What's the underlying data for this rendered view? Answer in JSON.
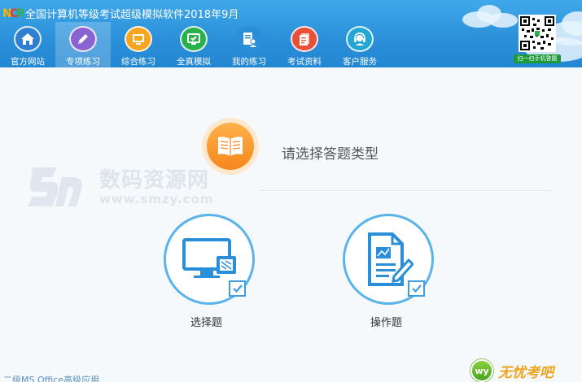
{
  "app": {
    "logo_text": "NCRE",
    "title": "全国计算机等级考试超级模拟软件2018年9月"
  },
  "nav": {
    "items": [
      {
        "label": "官方网站",
        "icon": "home-icon",
        "active": false
      },
      {
        "label": "专项练习",
        "icon": "pencil-icon",
        "active": true
      },
      {
        "label": "综合练习",
        "icon": "monitor-icon",
        "active": false
      },
      {
        "label": "全真模拟",
        "icon": "screen-check-icon",
        "active": false
      },
      {
        "label": "我的练习",
        "icon": "user-list-icon",
        "active": false
      },
      {
        "label": "考试资料",
        "icon": "documents-icon",
        "active": false
      },
      {
        "label": "客户服务",
        "icon": "headset-icon",
        "active": false
      }
    ]
  },
  "qr": {
    "caption": "扫一扫手机答题"
  },
  "main": {
    "prompt": "请选择答题类型",
    "choices": [
      {
        "label": "选择题",
        "icon": "monitor-choice-icon"
      },
      {
        "label": "操作题",
        "icon": "document-edit-icon"
      }
    ]
  },
  "watermark": {
    "big": "数码资源网",
    "url": "www.smzy.com"
  },
  "footer": {
    "subject": "二级MS Office高级应用",
    "brand_badge": "wy",
    "brand_name": "无忧考吧"
  },
  "colors": {
    "header_blue": "#2a8fd8",
    "accent_blue": "#5ab3ea",
    "orange": "#f5861e",
    "brand_green": "#4aa51d",
    "brand_orange": "#f0a31c"
  }
}
